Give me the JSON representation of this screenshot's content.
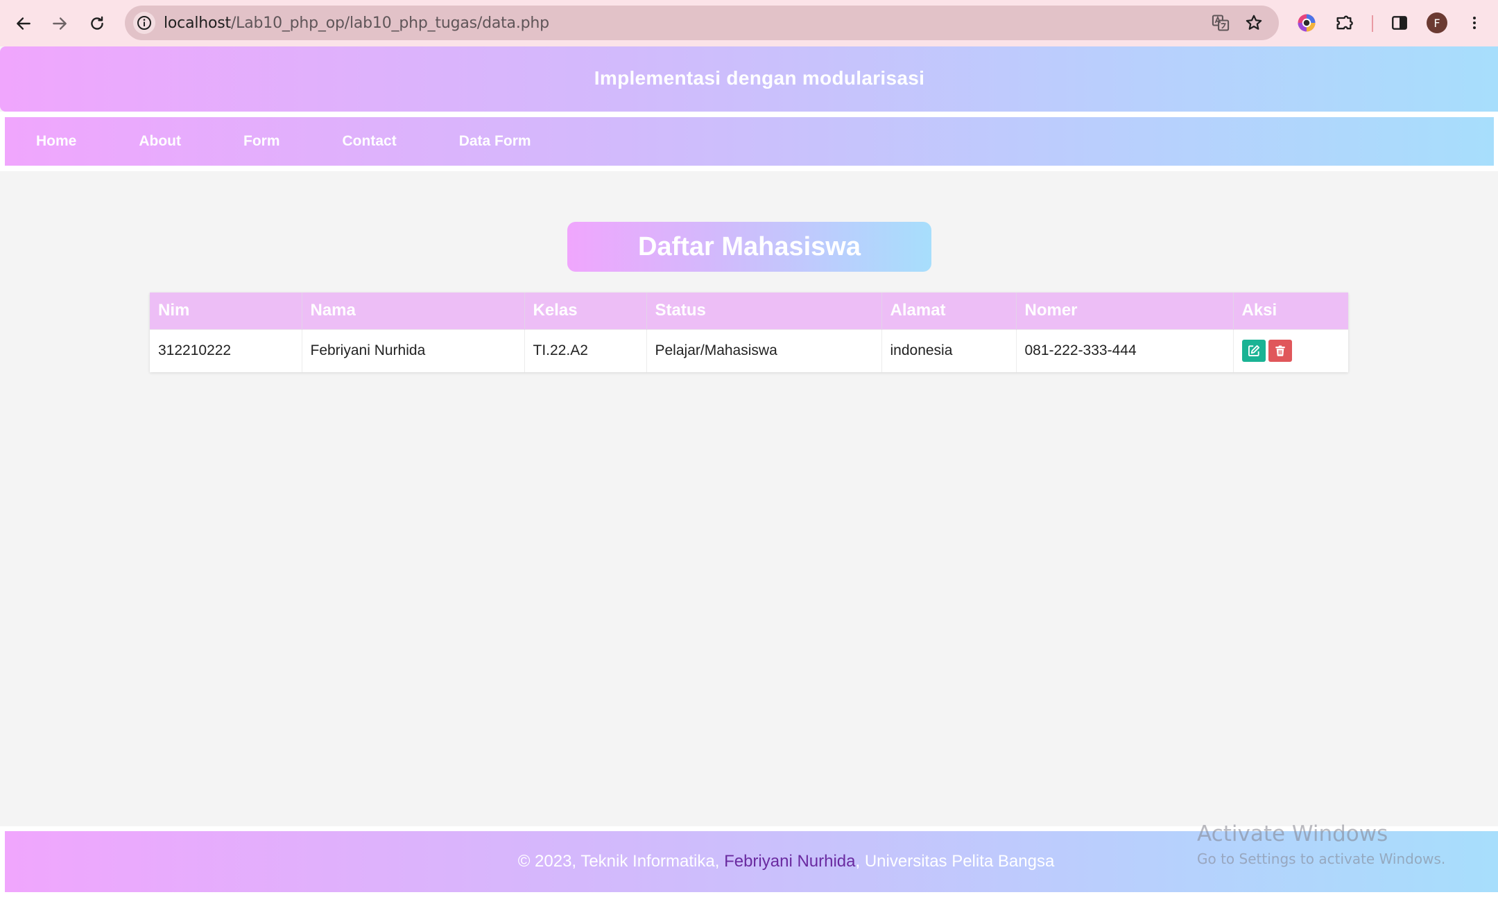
{
  "browser": {
    "url_host": "localhost",
    "url_path": "/Lab10_php_op/lab10_php_tugas/data.php",
    "profile_initial": "F",
    "icons": [
      "back-icon",
      "forward-icon",
      "reload-icon",
      "site-info-icon",
      "translate-icon",
      "bookmark-star-icon",
      "color-extension-icon",
      "extensions-puzzle-icon",
      "side-panel-icon",
      "menu-kebab-icon"
    ]
  },
  "header": {
    "title": "Implementasi dengan modularisasi"
  },
  "nav": {
    "items": [
      {
        "label": "Home"
      },
      {
        "label": "About"
      },
      {
        "label": "Form"
      },
      {
        "label": "Contact"
      },
      {
        "label": "Data Form"
      }
    ]
  },
  "main": {
    "title": "Daftar Mahasiswa",
    "table": {
      "columns": [
        "Nim",
        "Nama",
        "Kelas",
        "Status",
        "Alamat",
        "Nomer",
        "Aksi"
      ],
      "rows": [
        {
          "nim": "312210222",
          "nama": "Febriyani Nurhida",
          "kelas": "TI.22.A2",
          "status": "Pelajar/Mahasiswa",
          "alamat": "indonesia",
          "nomer": "081-222-333-444"
        }
      ],
      "actions": [
        "edit-icon",
        "delete-icon"
      ]
    }
  },
  "footer": {
    "prefix": "© 2023, Teknik Informatika, ",
    "author": "Febriyani Nurhida",
    "suffix": ", Universitas Pelita Bangsa"
  },
  "watermark": {
    "line1": "Activate Windows",
    "line2": "Go to Settings to activate Windows."
  },
  "colors": {
    "gradient_start": "#f0a6fd",
    "gradient_end": "#a7defc",
    "table_header": "#edbef6",
    "edit_button": "#1ab394",
    "delete_button": "#e0575b",
    "author_link": "#6a2aa0"
  }
}
